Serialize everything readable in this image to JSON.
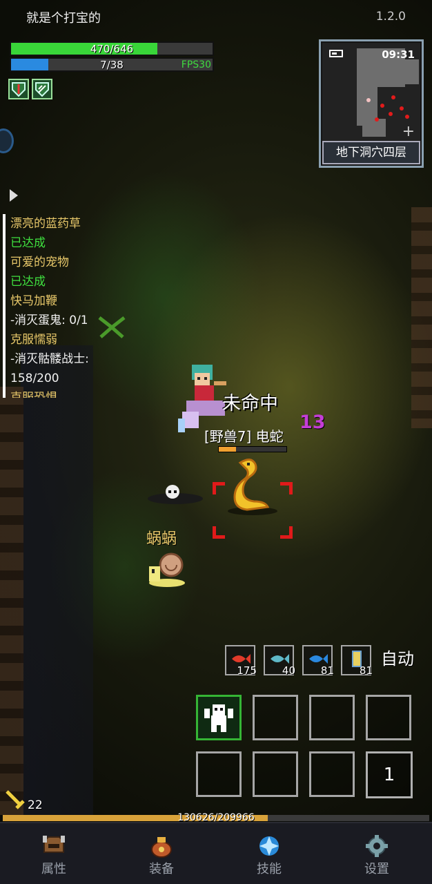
{
  "header": {
    "title": "就是个打宝的",
    "version": "1.2.0"
  },
  "status": {
    "hp_text": "470/646",
    "hp_fraction": 0.7276,
    "mp_text": "7/38",
    "mp_fraction": 0.184,
    "fps": "FPS30"
  },
  "minimap": {
    "time": "09:31",
    "area": "地下洞穴四层",
    "plus": "+"
  },
  "quests": [
    {
      "title": "漂亮的蓝药草",
      "status": "已达成"
    },
    {
      "title": "可爱的宠物",
      "status": "已达成"
    },
    {
      "title": "快马加鞭",
      "progress": "-消灭蛋鬼: 0/1"
    },
    {
      "title": "克服懦弱",
      "progress": "-消灭骷髅战士:",
      "progress2": "158/200"
    },
    {
      "title": "克服恐惧"
    }
  ],
  "combat": {
    "miss_text": "未命中",
    "damage": "13",
    "enemy_name": "[野兽7] 电蛇",
    "enemy_hp_fraction": 0.25,
    "npc_name": "蜗蜗"
  },
  "consumables": [
    {
      "icon": "red-fish-icon",
      "qty": "175",
      "color": "#e23a2a"
    },
    {
      "icon": "teal-fish-icon",
      "qty": "40",
      "color": "#5fb8c8"
    },
    {
      "icon": "blue-fish-icon",
      "qty": "81",
      "color": "#2a88e0"
    },
    {
      "icon": "scroll-icon",
      "qty": "81",
      "color": "#e8d060"
    }
  ],
  "auto_label": "自动",
  "skill_page": "1",
  "level": "22",
  "exp": {
    "text": "130626/209966",
    "fraction": 0.622
  },
  "nav": [
    {
      "label": "属性",
      "icon": "helmet-icon"
    },
    {
      "label": "装备",
      "icon": "bag-icon"
    },
    {
      "label": "技能",
      "icon": "crystal-icon"
    },
    {
      "label": "设置",
      "icon": "gear-icon"
    }
  ],
  "colors": {
    "hp": "#39d639",
    "mp": "#2a8ae0",
    "exp": "#d8a23a",
    "quest_title": "#e8c86a",
    "quest_done": "#3fe03f"
  }
}
